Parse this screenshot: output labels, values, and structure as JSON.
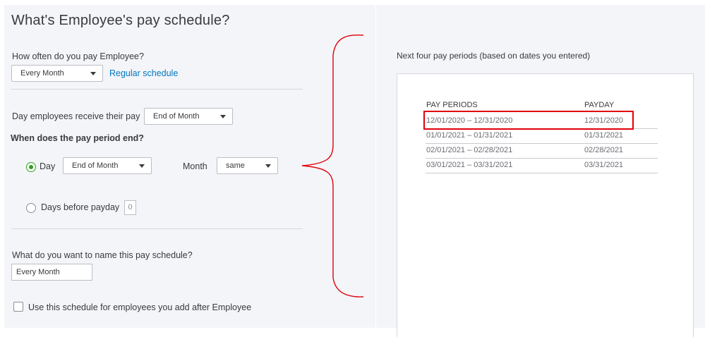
{
  "title": "What's Employee's pay schedule?",
  "frequency": {
    "label": "How often do you pay Employee?",
    "value": "Every Month",
    "link": "Regular schedule"
  },
  "payday": {
    "label": "Day employees receive their pay",
    "value": "End of Month"
  },
  "period_end": {
    "heading": "When does the pay period end?",
    "day_option_label": "Day",
    "day_value": "End of Month",
    "month_label": "Month",
    "month_value": "same",
    "days_before_label": "Days before payday",
    "days_before_value": "0"
  },
  "schedule_name": {
    "label": "What do you want to name this pay schedule?",
    "value": "Every Month"
  },
  "use_for_new": {
    "label": "Use this schedule for employees you add after Employee",
    "checked": false
  },
  "preview": {
    "heading": "Next four pay periods (based on dates you entered)",
    "col_period": "PAY PERIODS",
    "col_payday": "PAYDAY",
    "rows": [
      {
        "period": "12/01/2020 – 12/31/2020",
        "payday": "12/31/2020"
      },
      {
        "period": "01/01/2021 – 01/31/2021",
        "payday": "01/31/2021"
      },
      {
        "period": "02/01/2021 – 02/28/2021",
        "payday": "02/28/2021"
      },
      {
        "period": "03/01/2021 – 03/31/2021",
        "payday": "03/31/2021"
      }
    ]
  },
  "colors": {
    "accent_link": "#0077c5",
    "radio_checked": "#2ca01c",
    "annotation": "#e0000b"
  }
}
